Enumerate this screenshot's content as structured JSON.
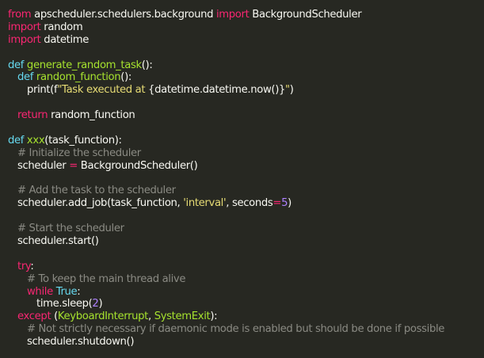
{
  "editor": {
    "lines": [
      {
        "indent": 0,
        "tokens": [
          {
            "t": "kw",
            "v": "from"
          },
          {
            "t": "plain",
            "v": " apscheduler.schedulers.background "
          },
          {
            "t": "kw",
            "v": "import"
          },
          {
            "t": "plain",
            "v": " BackgroundScheduler"
          }
        ]
      },
      {
        "indent": 0,
        "tokens": [
          {
            "t": "kw",
            "v": "import"
          },
          {
            "t": "plain",
            "v": " random"
          }
        ]
      },
      {
        "indent": 0,
        "tokens": [
          {
            "t": "kw",
            "v": "import"
          },
          {
            "t": "plain",
            "v": " datetime"
          }
        ]
      },
      {
        "indent": 0,
        "tokens": []
      },
      {
        "indent": 0,
        "tokens": [
          {
            "t": "def",
            "v": "def"
          },
          {
            "t": "plain",
            "v": " "
          },
          {
            "t": "fn",
            "v": "generate_random_task"
          },
          {
            "t": "plain",
            "v": "():"
          }
        ]
      },
      {
        "indent": 1,
        "tokens": [
          {
            "t": "def",
            "v": "def"
          },
          {
            "t": "plain",
            "v": " "
          },
          {
            "t": "fn",
            "v": "random_function"
          },
          {
            "t": "plain",
            "v": "():"
          }
        ]
      },
      {
        "indent": 2,
        "tokens": [
          {
            "t": "plain",
            "v": "print(f"
          },
          {
            "t": "str",
            "v": "\"Task executed at "
          },
          {
            "t": "plain",
            "v": "{datetime.datetime.now()}"
          },
          {
            "t": "str",
            "v": "\""
          },
          {
            "t": "plain",
            "v": ")"
          }
        ]
      },
      {
        "indent": 0,
        "tokens": []
      },
      {
        "indent": 1,
        "tokens": [
          {
            "t": "kw",
            "v": "return"
          },
          {
            "t": "plain",
            "v": " random_function"
          }
        ]
      },
      {
        "indent": 0,
        "tokens": []
      },
      {
        "indent": 0,
        "tokens": [
          {
            "t": "def",
            "v": "def"
          },
          {
            "t": "plain",
            "v": " "
          },
          {
            "t": "fn",
            "v": "xxx"
          },
          {
            "t": "plain",
            "v": "(task_function):"
          }
        ]
      },
      {
        "indent": 1,
        "tokens": [
          {
            "t": "cm",
            "v": "# Initialize the scheduler"
          }
        ]
      },
      {
        "indent": 1,
        "tokens": [
          {
            "t": "plain",
            "v": "scheduler "
          },
          {
            "t": "kw",
            "v": "="
          },
          {
            "t": "plain",
            "v": " BackgroundScheduler()"
          }
        ]
      },
      {
        "indent": 0,
        "tokens": []
      },
      {
        "indent": 1,
        "tokens": [
          {
            "t": "cm",
            "v": "# Add the task to the scheduler"
          }
        ]
      },
      {
        "indent": 1,
        "tokens": [
          {
            "t": "plain",
            "v": "scheduler.add_job(task_function, "
          },
          {
            "t": "str",
            "v": "'interval'"
          },
          {
            "t": "plain",
            "v": ", seconds"
          },
          {
            "t": "kw",
            "v": "="
          },
          {
            "t": "num",
            "v": "5"
          },
          {
            "t": "plain",
            "v": ")"
          }
        ]
      },
      {
        "indent": 0,
        "tokens": []
      },
      {
        "indent": 1,
        "tokens": [
          {
            "t": "cm",
            "v": "# Start the scheduler"
          }
        ]
      },
      {
        "indent": 1,
        "tokens": [
          {
            "t": "plain",
            "v": "scheduler.start()"
          }
        ]
      },
      {
        "indent": 0,
        "tokens": []
      },
      {
        "indent": 1,
        "tokens": [
          {
            "t": "kw",
            "v": "try"
          },
          {
            "t": "plain",
            "v": ":"
          }
        ]
      },
      {
        "indent": 2,
        "tokens": [
          {
            "t": "cm",
            "v": "# To keep the main thread alive"
          }
        ]
      },
      {
        "indent": 2,
        "tokens": [
          {
            "t": "kw",
            "v": "while"
          },
          {
            "t": "plain",
            "v": " "
          },
          {
            "t": "def",
            "v": "True"
          },
          {
            "t": "plain",
            "v": ":"
          }
        ]
      },
      {
        "indent": 3,
        "tokens": [
          {
            "t": "plain",
            "v": "time.sleep("
          },
          {
            "t": "num",
            "v": "2"
          },
          {
            "t": "plain",
            "v": ")"
          }
        ]
      },
      {
        "indent": 1,
        "tokens": [
          {
            "t": "kw",
            "v": "except"
          },
          {
            "t": "plain",
            "v": " ("
          },
          {
            "t": "bi",
            "v": "KeyboardInterrupt"
          },
          {
            "t": "plain",
            "v": ", "
          },
          {
            "t": "bi",
            "v": "SystemExit"
          },
          {
            "t": "plain",
            "v": "):"
          }
        ]
      },
      {
        "indent": 2,
        "tokens": [
          {
            "t": "cm",
            "v": "# Not strictly necessary if daemonic mode is enabled but should be done if possible"
          }
        ]
      },
      {
        "indent": 2,
        "tokens": [
          {
            "t": "plain",
            "v": "scheduler.shutdown()"
          }
        ]
      }
    ]
  },
  "colors": {
    "background": "#272822",
    "keyword": "#f92672",
    "definition": "#66d9ef",
    "function_name": "#a6e22e",
    "string": "#e6db74",
    "number": "#ae81ff",
    "comment": "#8a8a83",
    "text": "#f8f8f2"
  }
}
